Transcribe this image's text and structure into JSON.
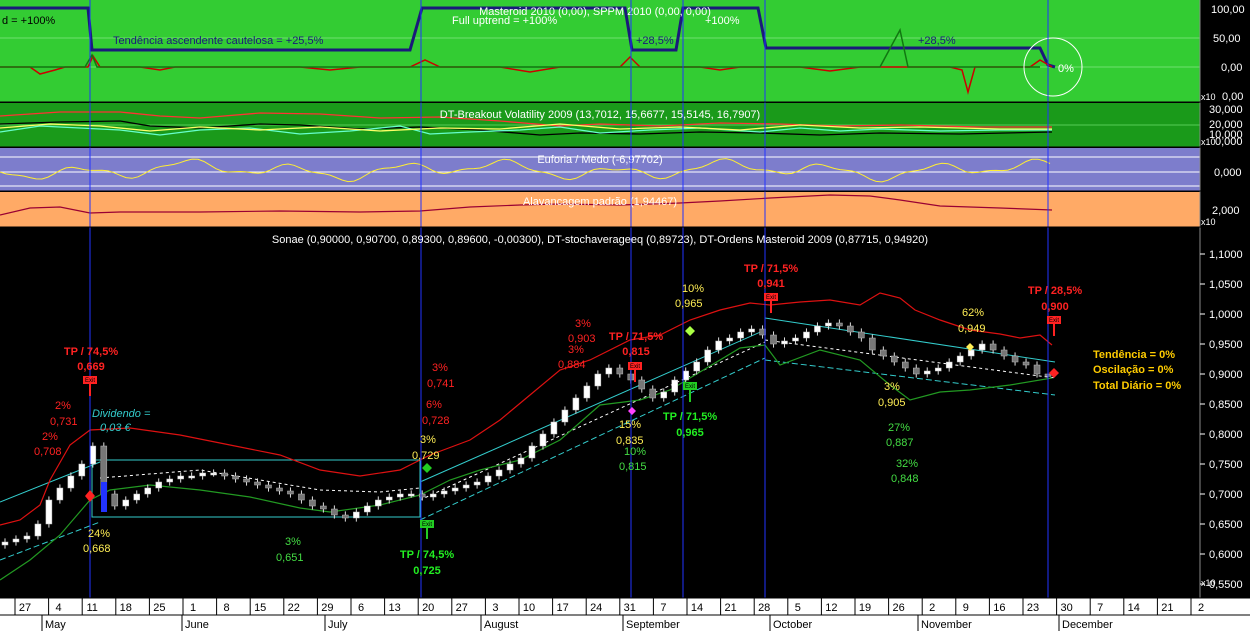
{
  "panels": {
    "masteroid": {
      "title": "Masteroid 2010 (0,00), SPPM 2010 (0,00, 0,00)",
      "labels": [
        "d = +100%",
        "Full uptrend = +100%",
        "Tendência ascendente cautelosa = +25,5%",
        "+28,5%",
        "+100%",
        "+28,5%",
        "0%"
      ],
      "ticks": [
        "100,00",
        "50,00",
        "0,00"
      ],
      "corner_ticks": [
        "x10",
        "0,00"
      ],
      "colors": {
        "bg": "#33cc33",
        "line": "#1a1a7a"
      }
    },
    "breakout": {
      "title": "DT-Breakout Volatility 2009 (13,7012, 15,6677, 15,5145, 16,7907)",
      "ticks": [
        "30,000",
        "20,000",
        "10,000"
      ],
      "corner_ticks": [
        "x10",
        "0,000"
      ],
      "colors": {
        "bg": "#1a9a1a"
      }
    },
    "euforia": {
      "title": "Euforia / Medo (-6,97702)",
      "ticks": [
        "0,000"
      ],
      "colors": {
        "bg": "#7d7dcc"
      }
    },
    "alavancagem": {
      "title": "Alavancagem padrão (1,94467)",
      "ticks": [
        "2,000"
      ],
      "corner_ticks": [
        "x10"
      ],
      "colors": {
        "bg": "#ffaa66"
      }
    }
  },
  "main": {
    "title": "Sonae (0,90000, 0,90700, 0,89300, 0,89600, -0,00300), DT-stochaverageeq (0,89723), DT-Ordens Masteroid 2009 (0,87715, 0,94920)",
    "summary": [
      "Tendência = 0%",
      "Oscilação = 0%",
      "Total Diário = 0%"
    ],
    "dividend": [
      "Dividendo =",
      "0,03 €"
    ],
    "scale_marker": "x10",
    "exit_marker": "Exit"
  },
  "chart_data": {
    "type": "candlestick",
    "ylim": [
      0.53,
      1.11
    ],
    "y_ticks": [
      1.1,
      1.05,
      1.0,
      0.95,
      0.9,
      0.85,
      0.8,
      0.75,
      0.7,
      0.65,
      0.6,
      0.55
    ],
    "y_tick_labels": [
      "1,1000",
      "1,0500",
      "1,0000",
      "0,9500",
      "0,9000",
      "0,8500",
      "0,8000",
      "0,7500",
      "0,7000",
      "0,6500",
      "0,6000",
      "0,5500"
    ],
    "x_day_labels": [
      "27",
      "4",
      "11",
      "18",
      "25",
      "1",
      "8",
      "15",
      "22",
      "29",
      "6",
      "13",
      "20",
      "27",
      "3",
      "10",
      "17",
      "24",
      "31",
      "7",
      "14",
      "21",
      "28",
      "5",
      "12",
      "19",
      "26",
      "2",
      "9",
      "16",
      "23",
      "30",
      "7",
      "14",
      "21",
      "2"
    ],
    "x_month_labels": [
      "May",
      "June",
      "July",
      "August",
      "September",
      "October",
      "November",
      "December"
    ],
    "close_path": [
      0.62,
      0.625,
      0.63,
      0.65,
      0.69,
      0.71,
      0.73,
      0.75,
      0.78,
      0.7,
      0.68,
      0.69,
      0.7,
      0.71,
      0.72,
      0.725,
      0.73,
      0.73,
      0.735,
      0.735,
      0.73,
      0.725,
      0.72,
      0.715,
      0.71,
      0.705,
      0.7,
      0.69,
      0.68,
      0.675,
      0.665,
      0.66,
      0.67,
      0.68,
      0.69,
      0.695,
      0.7,
      0.7,
      0.695,
      0.7,
      0.705,
      0.71,
      0.715,
      0.72,
      0.73,
      0.74,
      0.75,
      0.76,
      0.78,
      0.8,
      0.82,
      0.84,
      0.86,
      0.88,
      0.9,
      0.91,
      0.9,
      0.89,
      0.875,
      0.86,
      0.87,
      0.89,
      0.905,
      0.92,
      0.94,
      0.955,
      0.96,
      0.97,
      0.975,
      0.965,
      0.95,
      0.955,
      0.96,
      0.97,
      0.98,
      0.985,
      0.98,
      0.97,
      0.96,
      0.94,
      0.93,
      0.92,
      0.91,
      0.9,
      0.905,
      0.91,
      0.92,
      0.93,
      0.94,
      0.95,
      0.94,
      0.93,
      0.92,
      0.915,
      0.9,
      0.896
    ],
    "annotations_red": [
      {
        "label": "TP / 74,5%",
        "value": "0,669"
      },
      {
        "label": "TP / 71,5%",
        "value": "0,815"
      },
      {
        "label": "TP / 71,5%",
        "value": "0,941"
      },
      {
        "label": "TP / 28,5%",
        "value": "0,900"
      }
    ],
    "annotations_green": [
      {
        "label": "TP / 74,5%",
        "value": "0,725"
      },
      {
        "label": "TP / 71,5%",
        "value": "0,965"
      }
    ],
    "pct_labels_red": [
      "2%",
      "0,731",
      "2%",
      "0,708",
      "3%",
      "0,741",
      "6%",
      "0,728",
      "3%",
      "0,903",
      "3%",
      "0,884"
    ],
    "pct_labels_yellow": [
      "24%",
      "0,668",
      "3%",
      "0,729",
      "15%",
      "0,835",
      "10%",
      "0,965",
      "62%",
      "0,949",
      "3%",
      "0,905"
    ],
    "pct_labels_green": [
      "3%",
      "0,651",
      "10%",
      "0,815",
      "27%",
      "0,887",
      "32%",
      "0,848"
    ]
  }
}
